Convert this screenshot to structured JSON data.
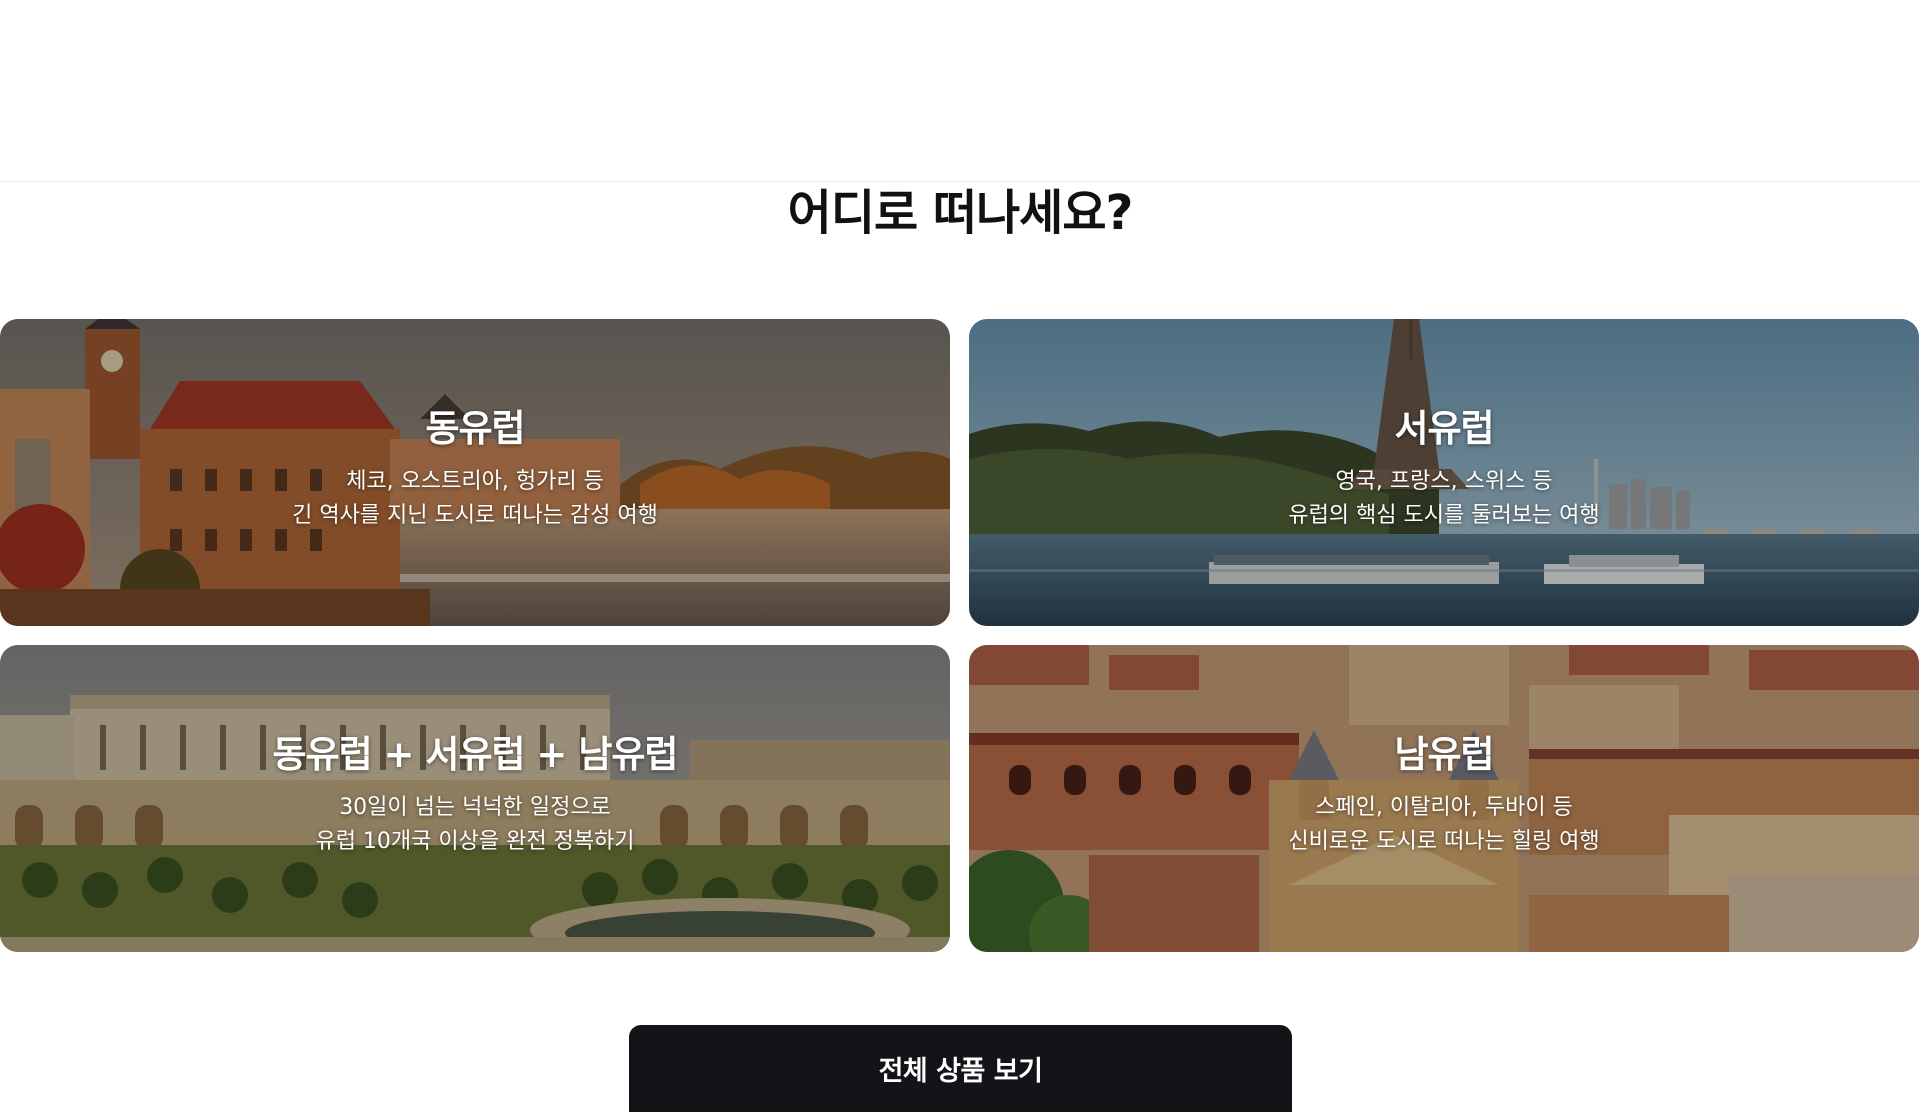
{
  "section": {
    "title": "어디로 떠나세요?"
  },
  "destinations": [
    {
      "title": "동유럽",
      "desc_line1": "체코, 오스트리아, 헝가리 등",
      "desc_line2": "긴 역사를 지닌 도시로 떠나는 감성 여행"
    },
    {
      "title": "서유럽",
      "desc_line1": "영국, 프랑스, 스위스 등",
      "desc_line2": "유럽의 핵심 도시를 둘러보는 여행"
    },
    {
      "title": "동유럽 + 서유럽 + 남유럽",
      "desc_line1": "30일이 넘는 넉넉한 일정으로",
      "desc_line2": "유럽 10개국 이상을 완전 정복하기"
    },
    {
      "title": "남유럽",
      "desc_line1": "스페인, 이탈리아, 두바이 등",
      "desc_line2": "신비로운 도시로 떠나는 힐링 여행"
    }
  ],
  "actions": {
    "view_all_label": "전체 상품 보기"
  }
}
